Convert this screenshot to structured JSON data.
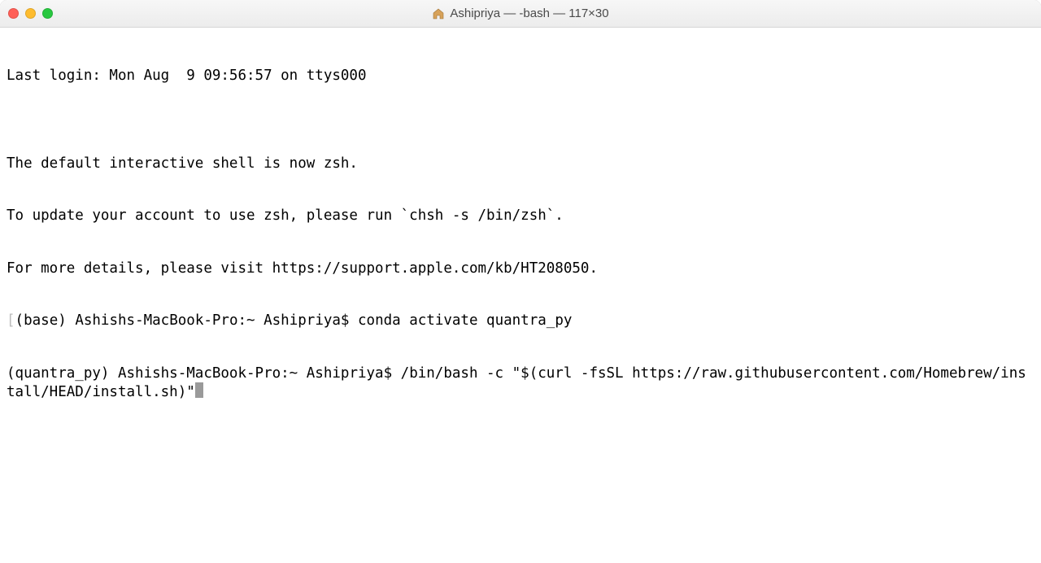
{
  "window": {
    "title": "Ashipriya — -bash — 117×30",
    "icon_name": "home-folder-icon"
  },
  "terminal": {
    "lines": [
      "Last login: Mon Aug  9 09:56:57 on ttys000",
      "",
      "The default interactive shell is now zsh.",
      "To update your account to use zsh, please run `chsh -s /bin/zsh`.",
      "For more details, please visit https://support.apple.com/kb/HT208050."
    ],
    "prompt1": {
      "prefix": "(base) ",
      "host": "Ashishs-MacBook-Pro:~ Ashipriya$ ",
      "command": "conda activate quantra_py"
    },
    "prompt2": {
      "prefix": "(quantra_py) ",
      "host": "Ashishs-MacBook-Pro:~ Ashipriya$ ",
      "command": "/bin/bash -c \"$(curl -fsSL https://raw.githubusercontent.com/Homebrew/install/HEAD/install.sh)\""
    }
  }
}
